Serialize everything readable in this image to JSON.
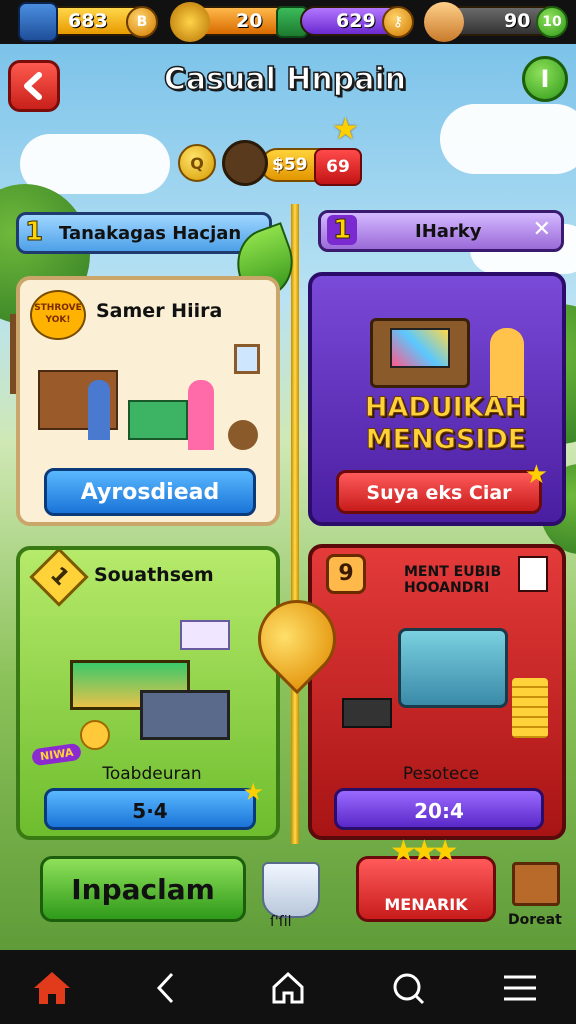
{
  "top_bar": {
    "resources": [
      {
        "value": "683",
        "icon": "crate-icon",
        "badge_icon": "coin-icon"
      },
      {
        "value": "20",
        "icon": "honey-pot-icon",
        "badge_icon": "gift-box-icon"
      },
      {
        "value": "629",
        "icon": "gift-box-icon",
        "badge_icon": "key-icon"
      },
      {
        "value": "90",
        "icon": "avatar-icon",
        "badge": "10"
      }
    ]
  },
  "header": {
    "title": "Casual Hnpain",
    "back_icon": "back-arrow-icon",
    "info_icon": "info-icon",
    "info_label": "I"
  },
  "center_row": {
    "coin_label": "Q",
    "price": "$59",
    "badge": "69"
  },
  "panels": {
    "left_tab": {
      "number": "1",
      "label": "Tanakagas Hacjan"
    },
    "right_tab": {
      "number": "1",
      "label": "IHarky",
      "close": "✕"
    },
    "card1": {
      "badge": "STHROVE YOK!",
      "title": "Samer Hiira",
      "button": "Ayrosdiead"
    },
    "card2": {
      "banner_line1": "HADUIKAH",
      "banner_line2": "MENGSIDE",
      "button": "Suya eks Ciar"
    },
    "card3": {
      "number": "1",
      "title": "Souathsem",
      "tag": "NIWA",
      "caption": "Toabdeuran",
      "value": "5·4"
    },
    "card4": {
      "number": "9",
      "title_line1": "MENT EUBIB",
      "title_line2": "HOOANDRI",
      "caption": "Pesotece",
      "value": "20:4"
    }
  },
  "bottom": {
    "primary_button": "Inpaclam",
    "cup_label": "ſ'ſil",
    "menarik_button": "MENARIK",
    "doreat_label": "Doreat"
  },
  "navbar": {
    "items": [
      {
        "icon": "home-icon",
        "color": "#e23b1b"
      },
      {
        "icon": "back-icon",
        "color": "#ffffff"
      },
      {
        "icon": "home-outline-icon",
        "color": "#ffffff"
      },
      {
        "icon": "search-icon",
        "color": "#ffffff"
      },
      {
        "icon": "menu-icon",
        "color": "#ffffff"
      }
    ]
  }
}
